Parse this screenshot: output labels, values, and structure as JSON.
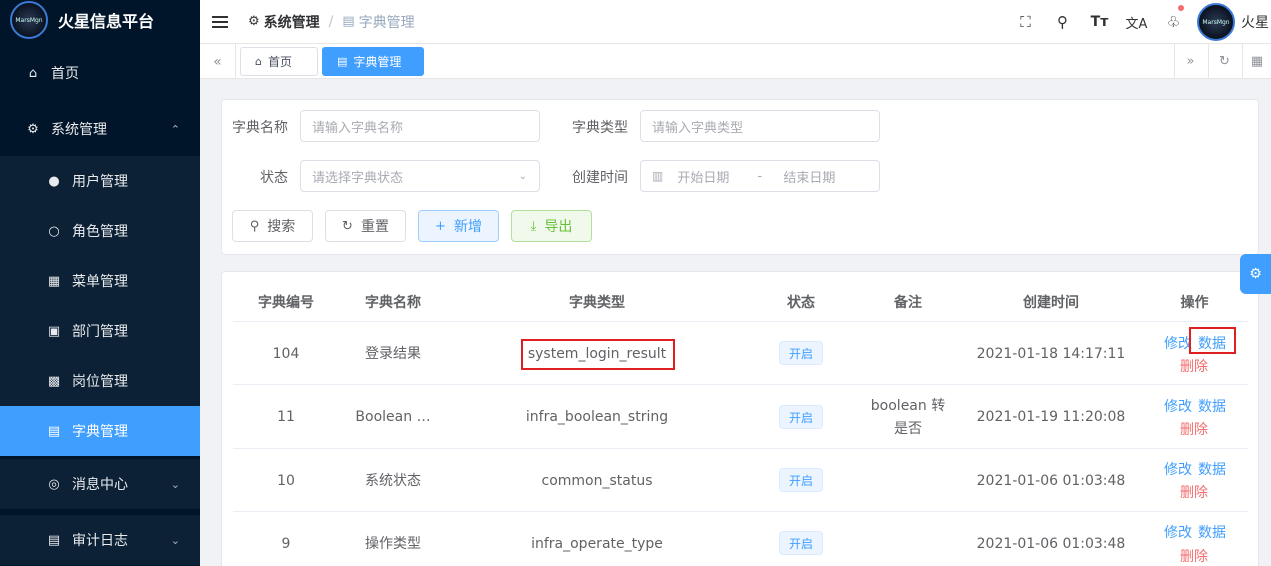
{
  "app": {
    "title": "火星信息平台",
    "logo_text": "MarsMgn"
  },
  "sidebar": {
    "items": [
      {
        "label": "首页",
        "icon": "home-icon"
      },
      {
        "label": "系统管理",
        "icon": "gear-icon"
      },
      {
        "label": "用户管理",
        "icon": "user-icon"
      },
      {
        "label": "角色管理",
        "icon": "person-outline-icon"
      },
      {
        "label": "菜单管理",
        "icon": "grid-icon"
      },
      {
        "label": "部门管理",
        "icon": "id-card-icon"
      },
      {
        "label": "岗位管理",
        "icon": "badge-icon"
      },
      {
        "label": "字典管理",
        "icon": "book-icon"
      },
      {
        "label": "消息中心",
        "icon": "chat-icon"
      },
      {
        "label": "审计日志",
        "icon": "log-icon"
      }
    ]
  },
  "navbar": {
    "breadcrumb": [
      "系统管理",
      "字典管理"
    ],
    "user_name": "火星",
    "icons": [
      "fullscreen-icon",
      "search-icon",
      "font-size-icon",
      "translate-icon",
      "bell-icon"
    ]
  },
  "tags": [
    {
      "label": "首页",
      "icon": "home-icon"
    },
    {
      "label": "字典管理",
      "icon": "book-icon"
    }
  ],
  "search": {
    "name_label": "字典名称",
    "name_placeholder": "请输入字典名称",
    "type_label": "字典类型",
    "type_placeholder": "请输入字典类型",
    "status_label": "状态",
    "status_placeholder": "请选择字典状态",
    "time_label": "创建时间",
    "start_placeholder": "开始日期",
    "range_sep": "-",
    "end_placeholder": "结束日期",
    "buttons": {
      "search": "搜索",
      "reset": "重置",
      "add": "新增",
      "export": "导出"
    }
  },
  "table": {
    "headers": [
      "字典编号",
      "字典名称",
      "字典类型",
      "状态",
      "备注",
      "创建时间",
      "操作"
    ],
    "rows": [
      {
        "id": "104",
        "name": "登录结果",
        "type": "system_login_result",
        "status": "开启",
        "remark": "",
        "created": "2021-01-18 14:17:11"
      },
      {
        "id": "11",
        "name": "Boolean …",
        "type": "infra_boolean_string",
        "status": "开启",
        "remark_l1": "boolean 转",
        "remark_l2": "是否",
        "created": "2021-01-19 11:20:08"
      },
      {
        "id": "10",
        "name": "系统状态",
        "type": "common_status",
        "status": "开启",
        "remark": "",
        "created": "2021-01-06 01:03:48"
      },
      {
        "id": "9",
        "name": "操作类型",
        "type": "infra_operate_type",
        "status": "开启",
        "remark": "",
        "created": "2021-01-06 01:03:48"
      }
    ],
    "actions": {
      "edit": "修改",
      "data": "数据",
      "delete": "删除"
    }
  },
  "colors": {
    "sidebar_bg": "#001529",
    "primary": "#409eff",
    "danger": "#f56c6c",
    "success": "#67c23a",
    "highlight": "#e02020"
  }
}
